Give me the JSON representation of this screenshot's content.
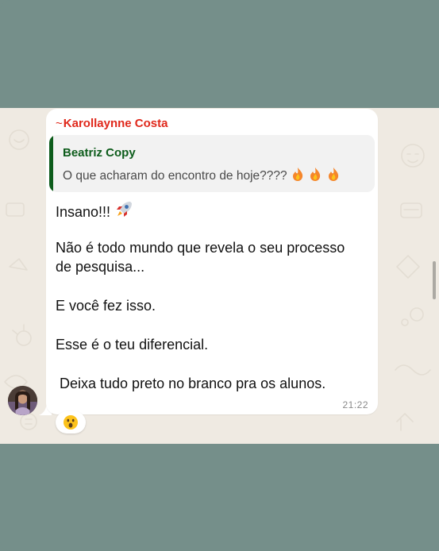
{
  "message": {
    "sender_name": "Karollaynne Costa",
    "sender_prefix": "~",
    "quoted": {
      "author": "Beatriz Copy",
      "text": "O que acharam do encontro de hoje????",
      "emojis": [
        "fire",
        "fire",
        "fire"
      ]
    },
    "lines": [
      "Insano!!!",
      "Não é todo mundo que revela o seu processo",
      "de pesquisa...",
      "E você fez isso.",
      "Esse é o teu diferencial.",
      " Deixa tudo preto no branco pra os alunos."
    ],
    "first_line_emoji": "rocket",
    "time": "21:22",
    "reaction": "astonished-face"
  },
  "colors": {
    "frame_bg": "#758f8a",
    "chat_bg": "#efeae2",
    "bubble_bg": "#ffffff",
    "sender_color": "#e0281b",
    "quote_accent": "#0d5c1b"
  }
}
